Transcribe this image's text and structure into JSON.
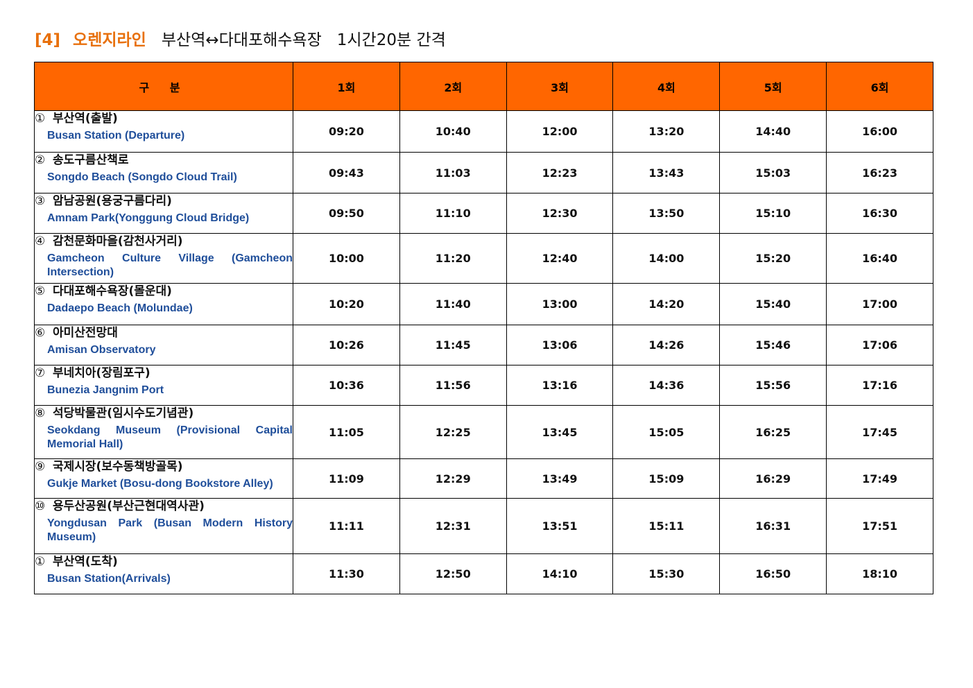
{
  "title": {
    "tag": "[4]",
    "line_name": "오렌지라인",
    "route": "부산역↔다대포해수욕장",
    "interval": "1시간20분 간격"
  },
  "table": {
    "headers": [
      "구 분",
      "1회",
      "2회",
      "3회",
      "4회",
      "5회",
      "6회"
    ],
    "rows": [
      {
        "num": "①",
        "ko": "부산역(출발)",
        "en": "Busan Station (Departure)",
        "times": [
          "09:20",
          "10:40",
          "12:00",
          "13:20",
          "14:40",
          "16:00"
        ]
      },
      {
        "num": "②",
        "ko": "송도구름산책로",
        "en": "Songdo Beach (Songdo Cloud Trail)",
        "times": [
          "09:43",
          "11:03",
          "12:23",
          "13:43",
          "15:03",
          "16:23"
        ]
      },
      {
        "num": "③",
        "ko": "암남공원(용궁구름다리)",
        "en": "Amnam Park(Yonggung Cloud Bridge)",
        "times": [
          "09:50",
          "11:10",
          "12:30",
          "13:50",
          "15:10",
          "16:30"
        ]
      },
      {
        "num": "④",
        "ko": "감천문화마을(감천사거리)",
        "en": "Gamcheon Culture Village (Gamcheon Intersection)",
        "times": [
          "10:00",
          "11:20",
          "12:40",
          "14:00",
          "15:20",
          "16:40"
        ]
      },
      {
        "num": "⑤",
        "ko": "다대포해수욕장(몰운대)",
        "en": "Dadaepo Beach (Molundae)",
        "times": [
          "10:20",
          "11:40",
          "13:00",
          "14:20",
          "15:40",
          "17:00"
        ]
      },
      {
        "num": "⑥",
        "ko": "아미산전망대",
        "en": "Amisan Observatory",
        "times": [
          "10:26",
          "11:45",
          "13:06",
          "14:26",
          "15:46",
          "17:06"
        ]
      },
      {
        "num": "⑦",
        "ko": "부네치아(장림포구)",
        "en": "Bunezia Jangnim Port",
        "times": [
          "10:36",
          "11:56",
          "13:16",
          "14:36",
          "15:56",
          "17:16"
        ]
      },
      {
        "num": "⑧",
        "ko": "석당박물관(임시수도기념관)",
        "en": "Seokdang Museum (Provisional Capital Memorial Hall)",
        "times": [
          "11:05",
          "12:25",
          "13:45",
          "15:05",
          "16:25",
          "17:45"
        ]
      },
      {
        "num": "⑨",
        "ko": "국제시장(보수동책방골목)",
        "en": "Gukje Market (Bosu-dong Bookstore Alley)",
        "times": [
          "11:09",
          "12:29",
          "13:49",
          "15:09",
          "16:29",
          "17:49"
        ]
      },
      {
        "num": "⑩",
        "ko": "용두산공원(부산근현대역사관)",
        "en": "Yongdusan Park (Busan Modern History Museum)",
        "times": [
          "11:11",
          "12:31",
          "13:51",
          "15:11",
          "16:31",
          "17:51"
        ]
      },
      {
        "num": "①",
        "ko": "부산역(도착)",
        "en": "Busan Station(Arrivals)",
        "times": [
          "11:30",
          "12:50",
          "14:10",
          "15:30",
          "16:50",
          "18:10"
        ]
      }
    ]
  },
  "colors": {
    "header_bg": "#FF6600",
    "title_accent": "#E8700C",
    "english_text": "#1F4E9A"
  }
}
